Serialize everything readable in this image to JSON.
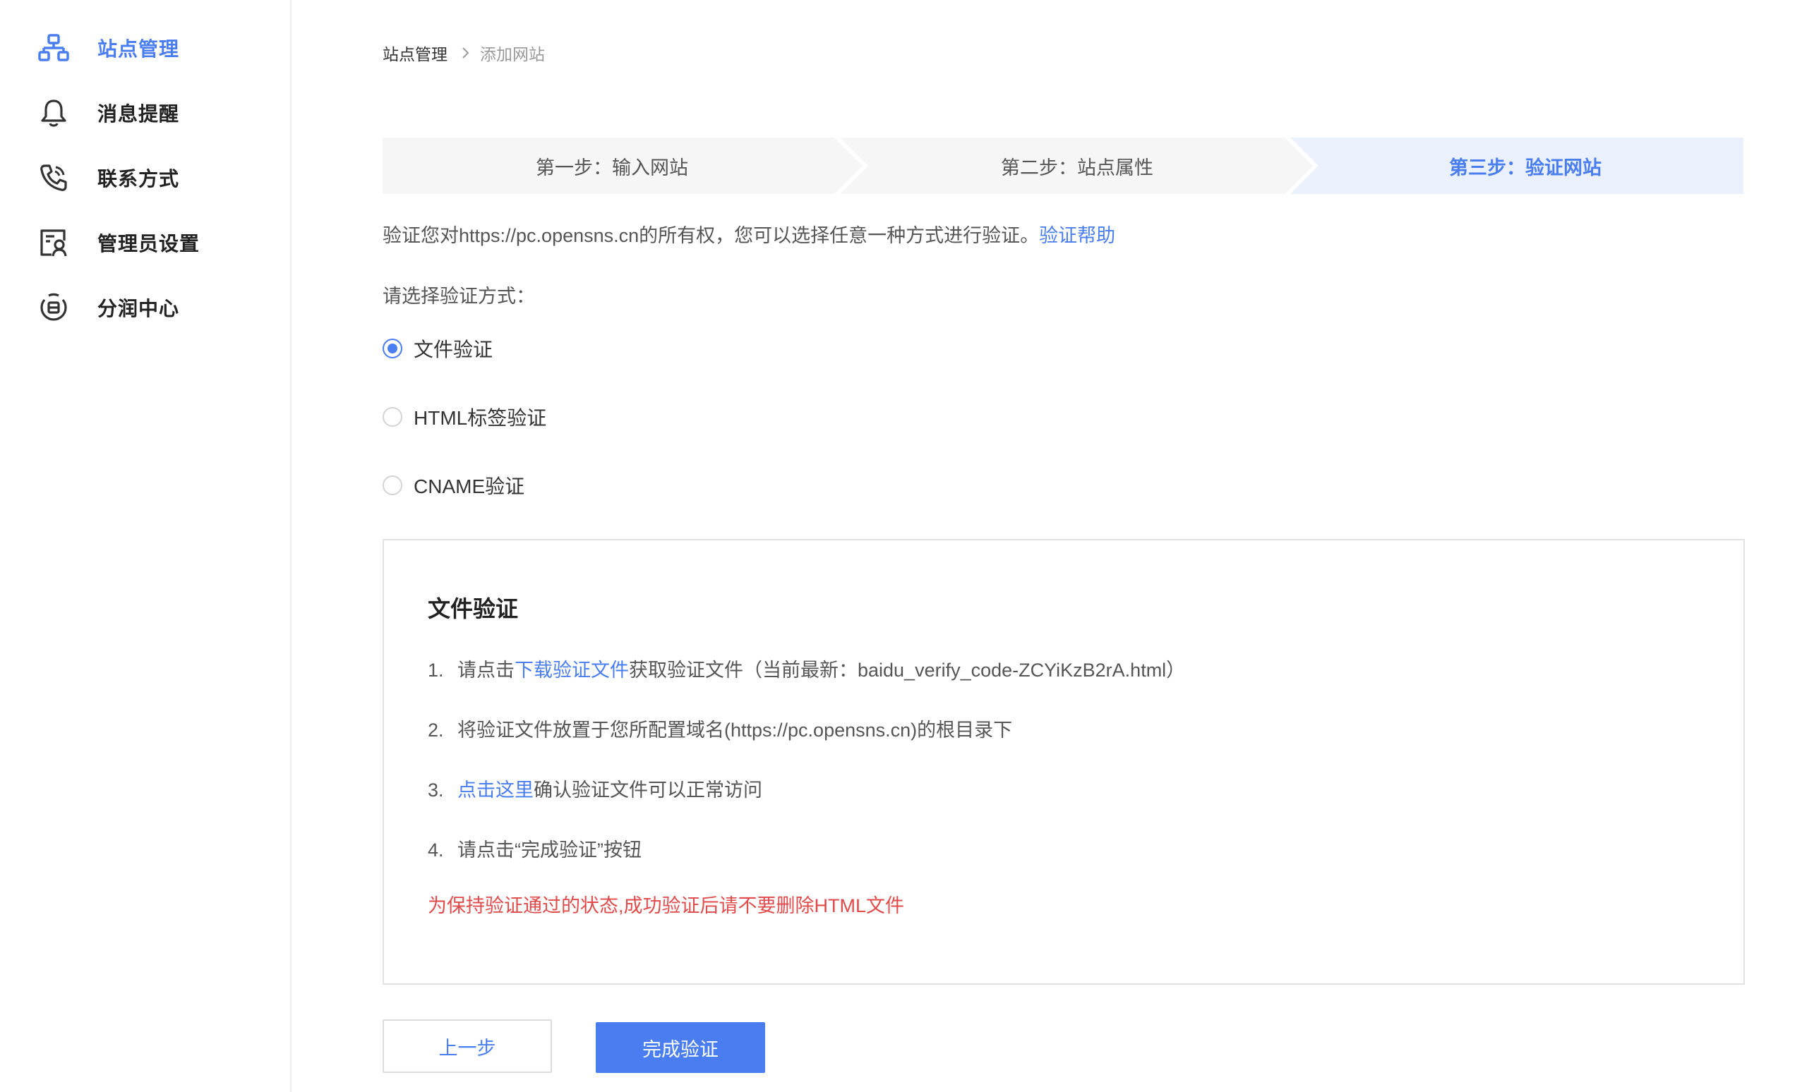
{
  "sidebar": {
    "items": [
      {
        "label": "站点管理",
        "icon": "sitemap-icon",
        "active": true
      },
      {
        "label": "消息提醒",
        "icon": "bell-icon",
        "active": false
      },
      {
        "label": "联系方式",
        "icon": "phone-icon",
        "active": false
      },
      {
        "label": "管理员设置",
        "icon": "admin-user-icon",
        "active": false
      },
      {
        "label": "分润中心",
        "icon": "revenue-share-icon",
        "active": false
      }
    ]
  },
  "breadcrumb": {
    "home": "站点管理",
    "current": "添加网站"
  },
  "steps": [
    {
      "label": "第一步：输入网站",
      "active": false
    },
    {
      "label": "第二步：站点属性",
      "active": false
    },
    {
      "label": "第三步：验证网站",
      "active": true
    }
  ],
  "intro": {
    "text": "验证您对https://pc.opensns.cn的所有权，您可以选择任意一种方式进行验证。",
    "help_link": "验证帮助"
  },
  "verify_method": {
    "label": "请选择验证方式：",
    "options": [
      {
        "label": "文件验证",
        "checked": true
      },
      {
        "label": "HTML标签验证",
        "checked": false
      },
      {
        "label": "CNAME验证",
        "checked": false
      }
    ]
  },
  "panel": {
    "title": "文件验证",
    "steps": [
      {
        "num": "1.",
        "before": "请点击",
        "link": "下载验证文件",
        "after": "获取验证文件（当前最新：baidu_verify_code-ZCYiKzB2rA.html）"
      },
      {
        "num": "2.",
        "before": "将验证文件放置于您所配置域名(https://pc.opensns.cn)的根目录下",
        "link": "",
        "after": ""
      },
      {
        "num": "3.",
        "before": "",
        "link": "点击这里",
        "after": "确认验证文件可以正常访问"
      },
      {
        "num": "4.",
        "before": "请点击“完成验证”按钮",
        "link": "",
        "after": ""
      }
    ],
    "warning": "为保持验证通过的状态,成功验证后请不要删除HTML文件"
  },
  "buttons": {
    "prev": "上一步",
    "done": "完成验证"
  },
  "colors": {
    "accent": "#4a7ef0",
    "warning": "#e04a4a",
    "step_active_bg": "#eaf1fd",
    "step_bg": "#f6f6f6"
  }
}
